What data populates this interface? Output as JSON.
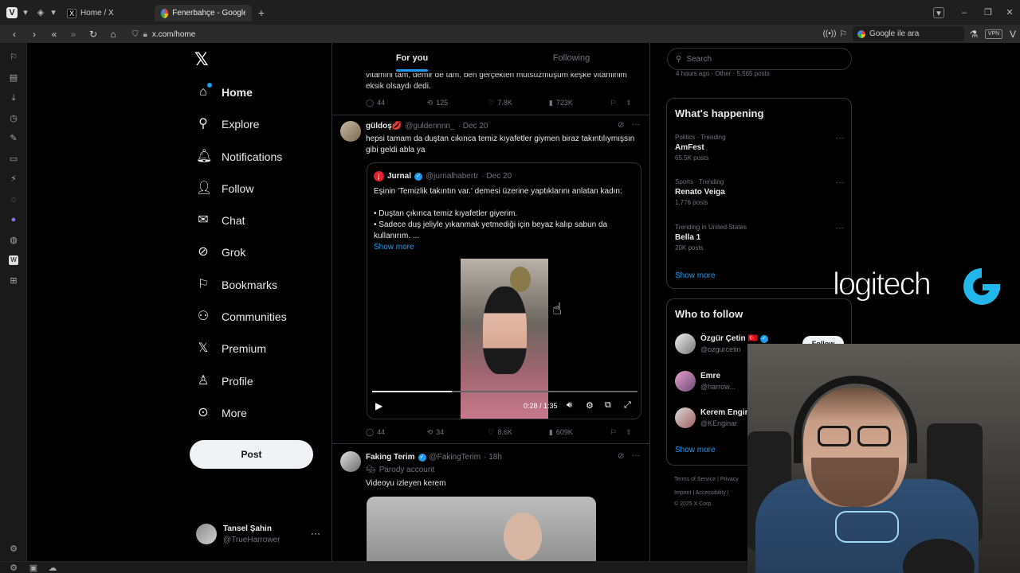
{
  "browser": {
    "tabs": [
      {
        "label": "Home / X",
        "active": false
      },
      {
        "label": "Fenerbahçe - Google'da Ar",
        "active": true
      }
    ],
    "new_tab": "+",
    "url": "x.com/home",
    "search_placeholder": "Google ile ara",
    "vpn": "VPN"
  },
  "nav": {
    "items": [
      {
        "label": "Home",
        "icon": "home-icon"
      },
      {
        "label": "Explore",
        "icon": "search-icon"
      },
      {
        "label": "Notifications",
        "icon": "bell-icon"
      },
      {
        "label": "Follow",
        "icon": "add-user-icon"
      },
      {
        "label": "Chat",
        "icon": "mail-icon"
      },
      {
        "label": "Grok",
        "icon": "grok-icon"
      },
      {
        "label": "Bookmarks",
        "icon": "bookmark-icon"
      },
      {
        "label": "Communities",
        "icon": "communities-icon"
      },
      {
        "label": "Premium",
        "icon": "x-icon"
      },
      {
        "label": "Profile",
        "icon": "profile-icon"
      },
      {
        "label": "More",
        "icon": "more-circle-icon"
      }
    ],
    "post_label": "Post",
    "account": {
      "name": "Tansel Şahin",
      "handle": "@TrueHarrower"
    }
  },
  "feed": {
    "tabs": [
      "For you",
      "Following"
    ],
    "prev_tweet": {
      "text": "vitamini tam, demir de tam. ben gerçekten mutsuzmuşum keşke vitaminim eksik olsaydı dedi.",
      "replies": "44",
      "reposts": "125",
      "likes": "7.8K",
      "views": "723K"
    },
    "tweet1": {
      "name": "güldoş💋",
      "handle": "@guldennnn_",
      "date": "· Dec 20",
      "text": "hepsi tamam da duştan cıkınca temiz kıyafetler giymen biraz takıntılıymışsın gibi geldi abla ya",
      "quote": {
        "name": "Jurnal",
        "handle": "@jurnalhabertr",
        "date": "· Dec 20",
        "line1": "Eşinin 'Temizlik takıntın var.' demesi üzerine yaptıklarını anlatan kadın:",
        "line2": "• Duştan çıkınca temiz kıyafetler giyerim.",
        "line3": "• Sadece duş jeliyle yıkanmak yetmediği için beyaz kalıp sabun da kullanırım. ...",
        "show_more": "Show more",
        "video_time": "0:28 / 1:35",
        "video_progress": 0.3
      },
      "replies": "44",
      "reposts": "34",
      "likes": "8.6K",
      "views": "609K"
    },
    "tweet2": {
      "name": "Faking Terim",
      "handle": "@FakingTerim",
      "date": "· 18h",
      "label": "Parody account",
      "text": "Videoyu izleyen kerem"
    }
  },
  "right": {
    "search_placeholder": "Search",
    "top_meta": "4 hours ago · Other · 5,565 posts",
    "happening_title": "What's happening",
    "trends": [
      {
        "category": "Politics · Trending",
        "name": "AmFest",
        "count": "65.5K posts"
      },
      {
        "category": "Sports · Trending",
        "name": "Renato Veiga",
        "count": "1,776 posts"
      },
      {
        "category": "Trending in United States",
        "name": "Bella 1",
        "count": "20K posts"
      }
    ],
    "show_more": "Show more",
    "who_title": "Who to follow",
    "follow": [
      {
        "name": "Özgür Çetin 🇹🇷",
        "handle": "@ozgurcetin"
      },
      {
        "name": "Emre",
        "handle": "@harrow..."
      },
      {
        "name": "Kerem Engin",
        "handle": "@KEnginar"
      }
    ],
    "follow_label": "Follow",
    "footer1": "Terms of Service  |  Privacy",
    "footer2": "Imprint  |  Accessibility  |",
    "footer3": "© 2025 X Corp."
  },
  "overlay": {
    "brand": "logitech"
  },
  "colors": {
    "accent": "#1d9bf0",
    "background": "#000000",
    "border": "#2f3336"
  }
}
